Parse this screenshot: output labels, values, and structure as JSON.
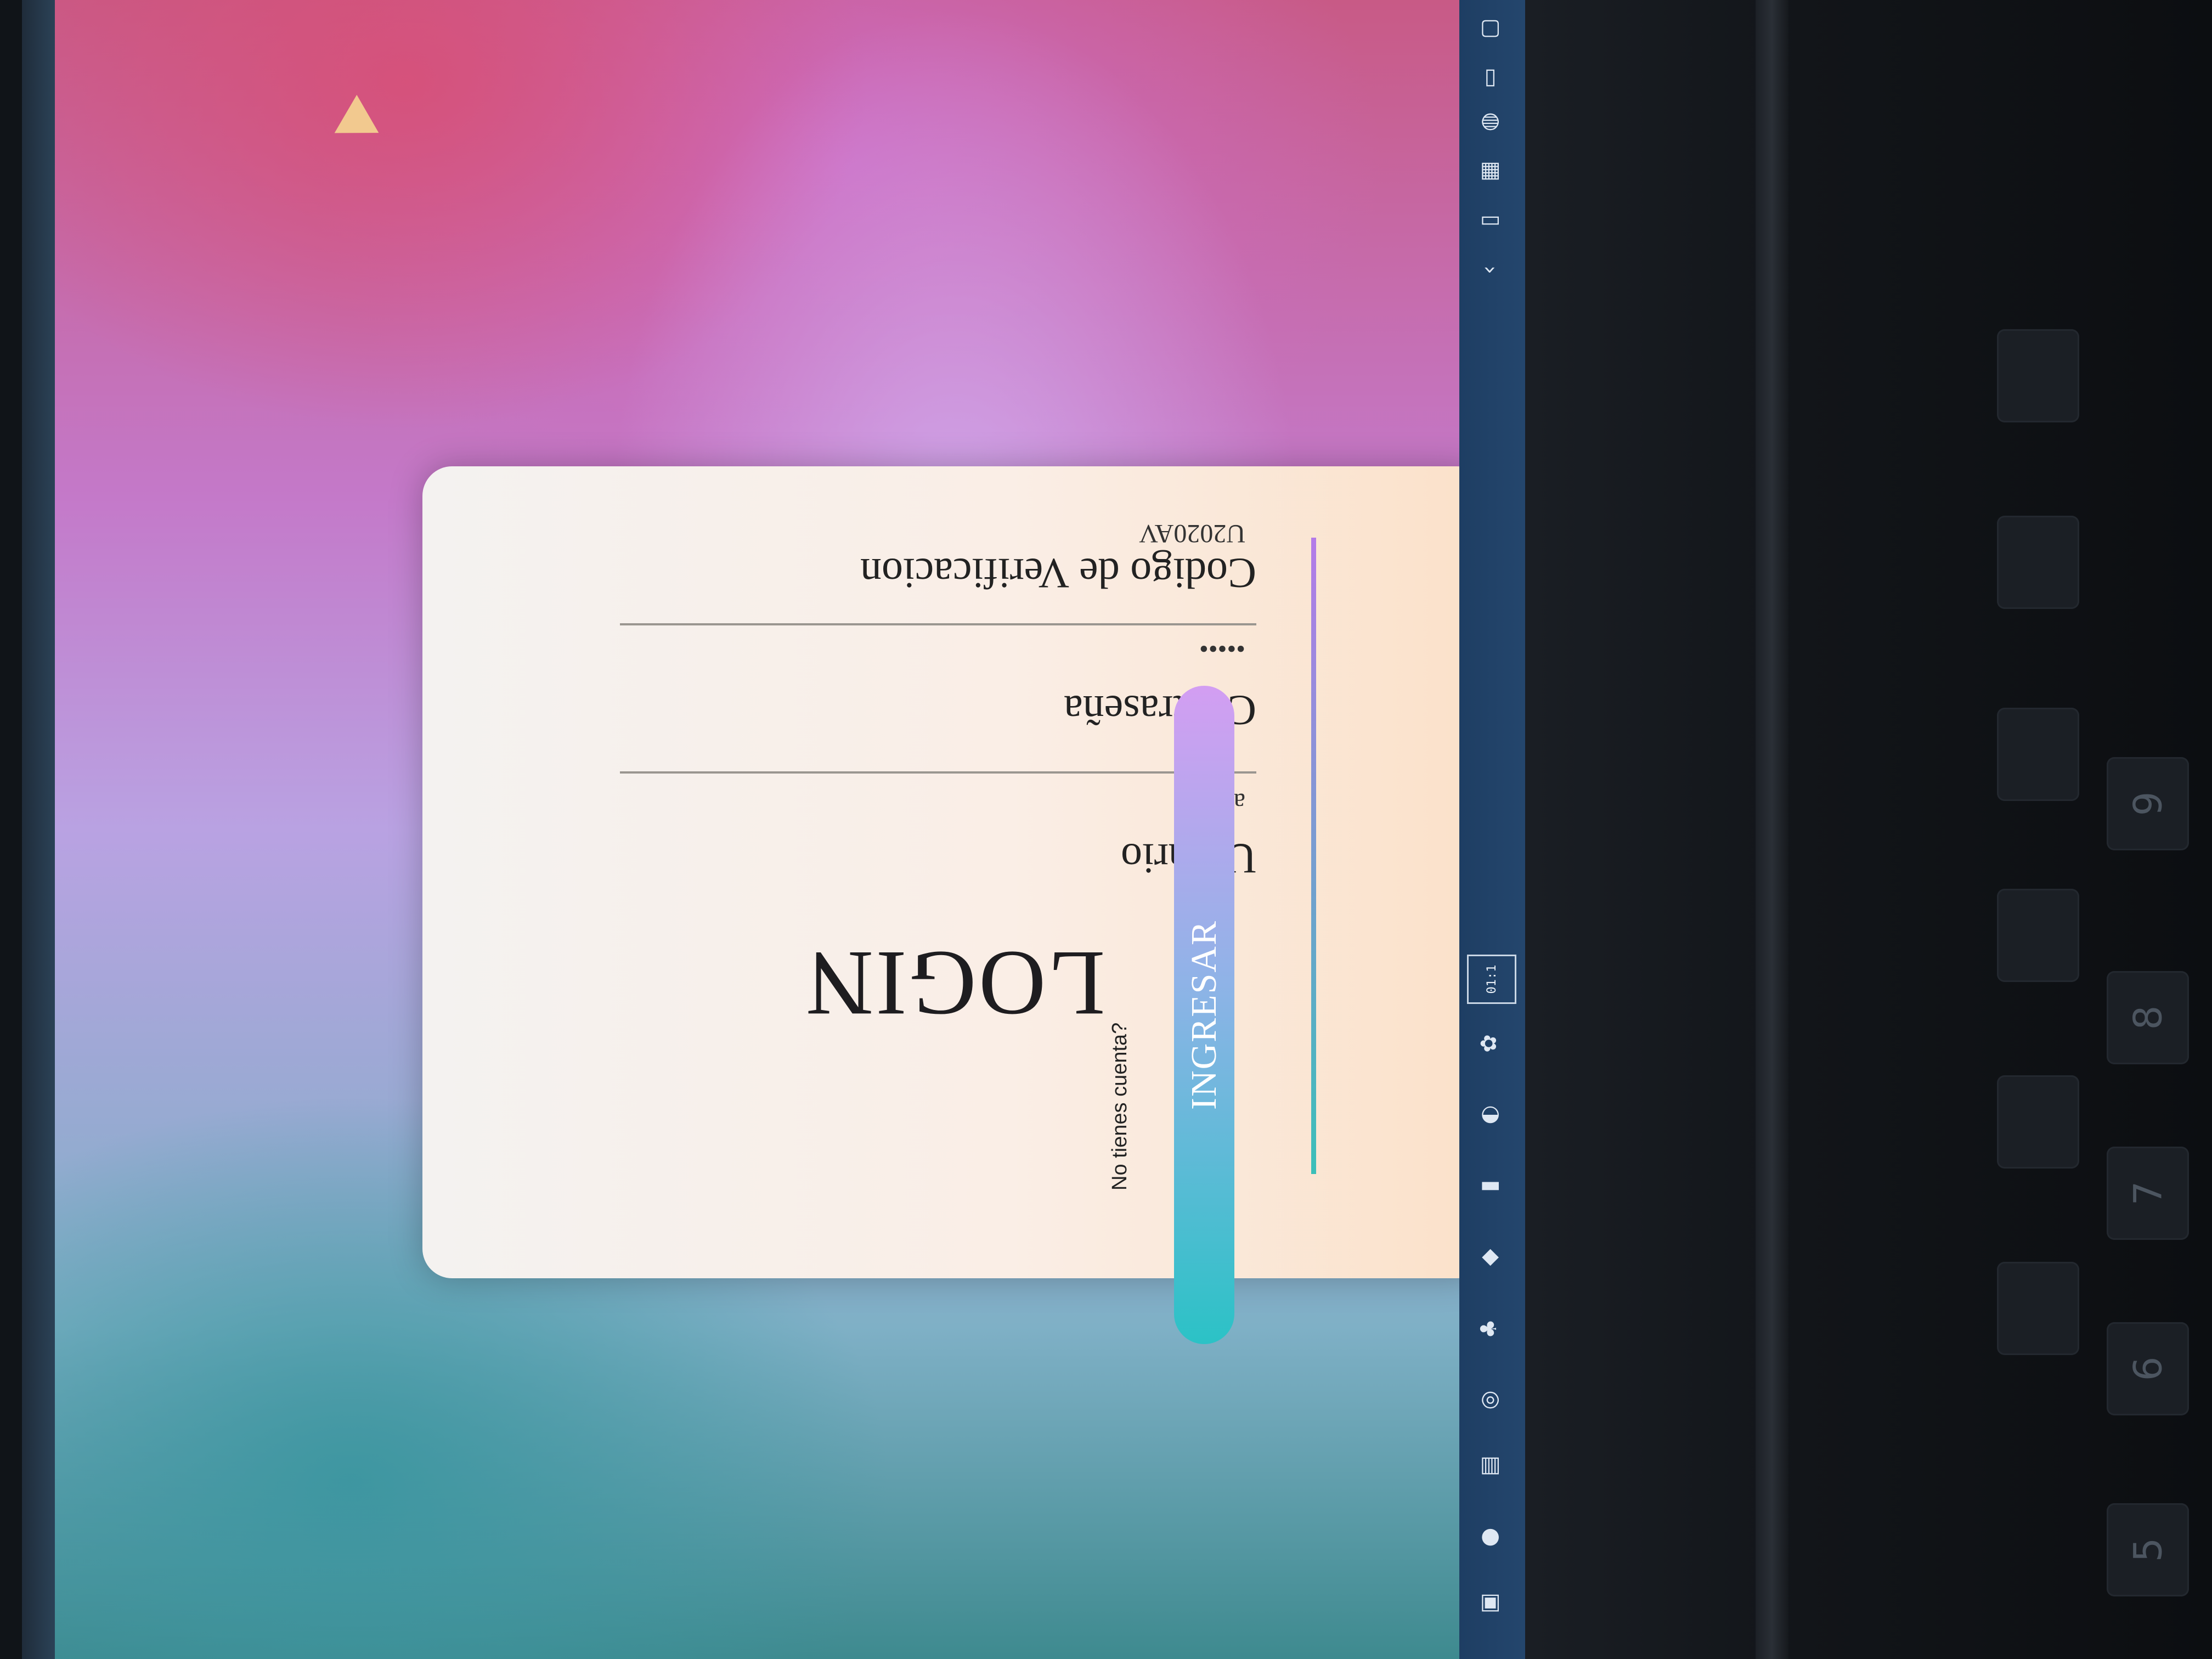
{
  "login": {
    "title": "LOGIN",
    "username_label": "Usuario",
    "username_value": "admin",
    "password_label": "Contraseña",
    "password_value": "•••••",
    "code_label": "Codigo de Verificacion",
    "code_value": "U2020AV",
    "signup_text": "No tienes cuenta?",
    "submit_label": "INGRESAR"
  },
  "taskbar": {
    "icons": [
      "task-view-icon",
      "app-icon",
      "terminal-icon",
      "chrome-icon",
      "teams-icon",
      "git-icon",
      "files-icon",
      "edge-icon",
      "office-icon"
    ],
    "clock_text": "01:1",
    "tray_icons": [
      "chevron-up-icon",
      "usb-icon",
      "network-icon",
      "edge-tray-icon",
      "battery-icon",
      "notification-icon"
    ]
  },
  "keyboard": {
    "keys": [
      "5",
      "6",
      "7",
      "8",
      "9"
    ]
  },
  "colors": {
    "button_start": "#2bc2c6",
    "button_end": "#d39ef2",
    "active_underline": "#b47be8"
  }
}
